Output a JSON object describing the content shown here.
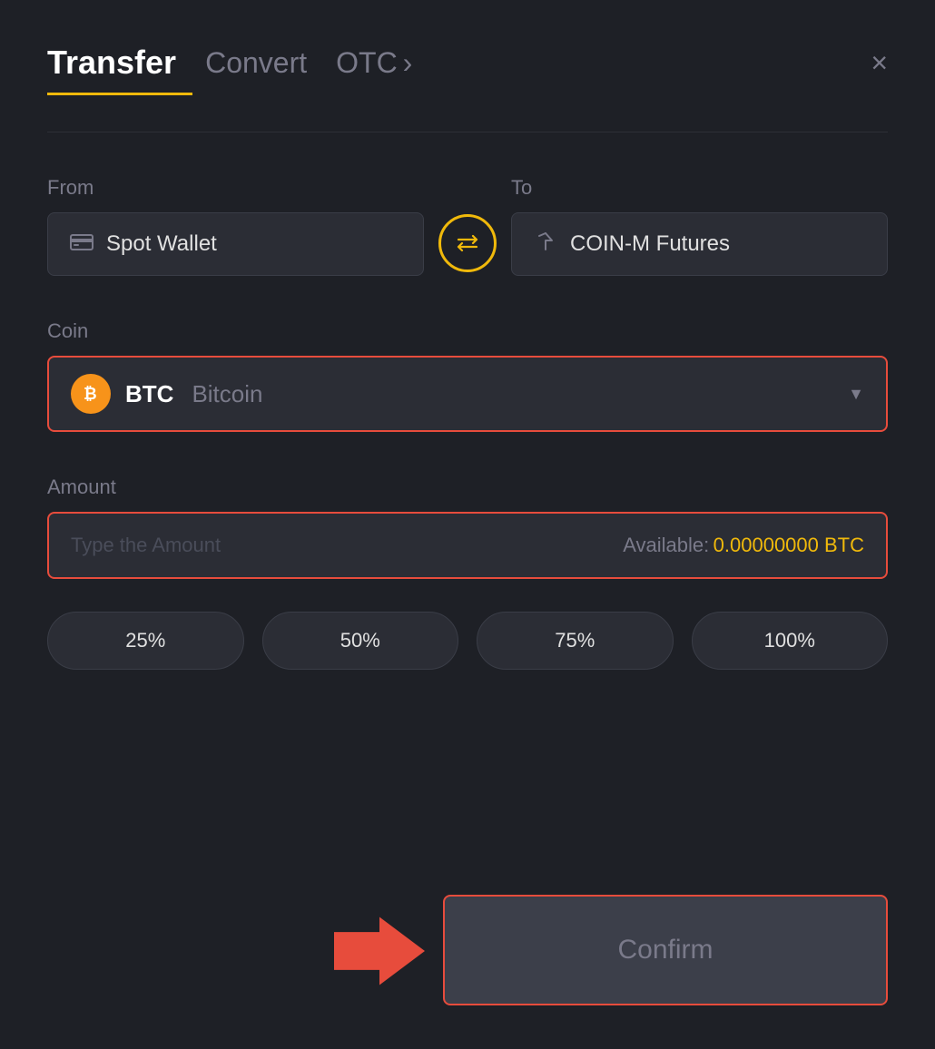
{
  "modal": {
    "title": "Transfer"
  },
  "header": {
    "tab_transfer": "Transfer",
    "tab_convert": "Convert",
    "tab_otc": "OTC",
    "tab_otc_chevron": "›",
    "close_label": "×"
  },
  "from": {
    "label": "From",
    "wallet_icon": "🎴",
    "wallet_name": "Spot Wallet"
  },
  "to": {
    "label": "To",
    "wallet_icon": "↑",
    "wallet_name": "COIN-M Futures"
  },
  "swap": {
    "icon_label": "swap-icon"
  },
  "coin": {
    "label": "Coin",
    "symbol": "BTC",
    "full_name": "Bitcoin",
    "btc_letter": "₿"
  },
  "amount": {
    "label": "Amount",
    "placeholder": "Type the Amount",
    "available_label": "Available:",
    "available_value": "0.00000000 BTC"
  },
  "percent_buttons": [
    "25%",
    "50%",
    "75%",
    "100%"
  ],
  "confirm": {
    "label": "Confirm"
  }
}
